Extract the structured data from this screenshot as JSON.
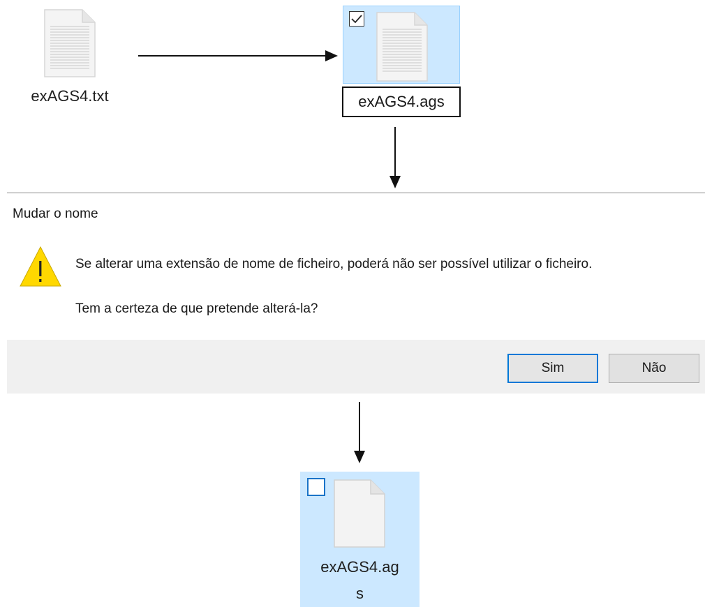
{
  "top_row": {
    "source_file": {
      "name": "exAGS4.txt",
      "icon": "text-file-icon"
    },
    "renamed_file": {
      "name": "exAGS4.ags",
      "icon": "text-file-icon",
      "selected": true,
      "checked": true
    }
  },
  "dialog": {
    "title": "Mudar o nome",
    "icon": "warning-icon",
    "message_line1": "Se alterar uma extensão de nome de ficheiro, poderá não ser possível utilizar o ficheiro.",
    "message_line2": "Tem a certeza de que pretende alterá-la?",
    "yes_label": "Sim",
    "no_label": "Não"
  },
  "result_file": {
    "name_line1": "exAGS4.ag",
    "name_line2": "s",
    "icon": "blank-file-icon",
    "selected": true,
    "checked": false
  },
  "colors": {
    "selection_bg": "#cce8ff",
    "accent": "#0078d7",
    "warning_yellow": "#ffd800"
  }
}
